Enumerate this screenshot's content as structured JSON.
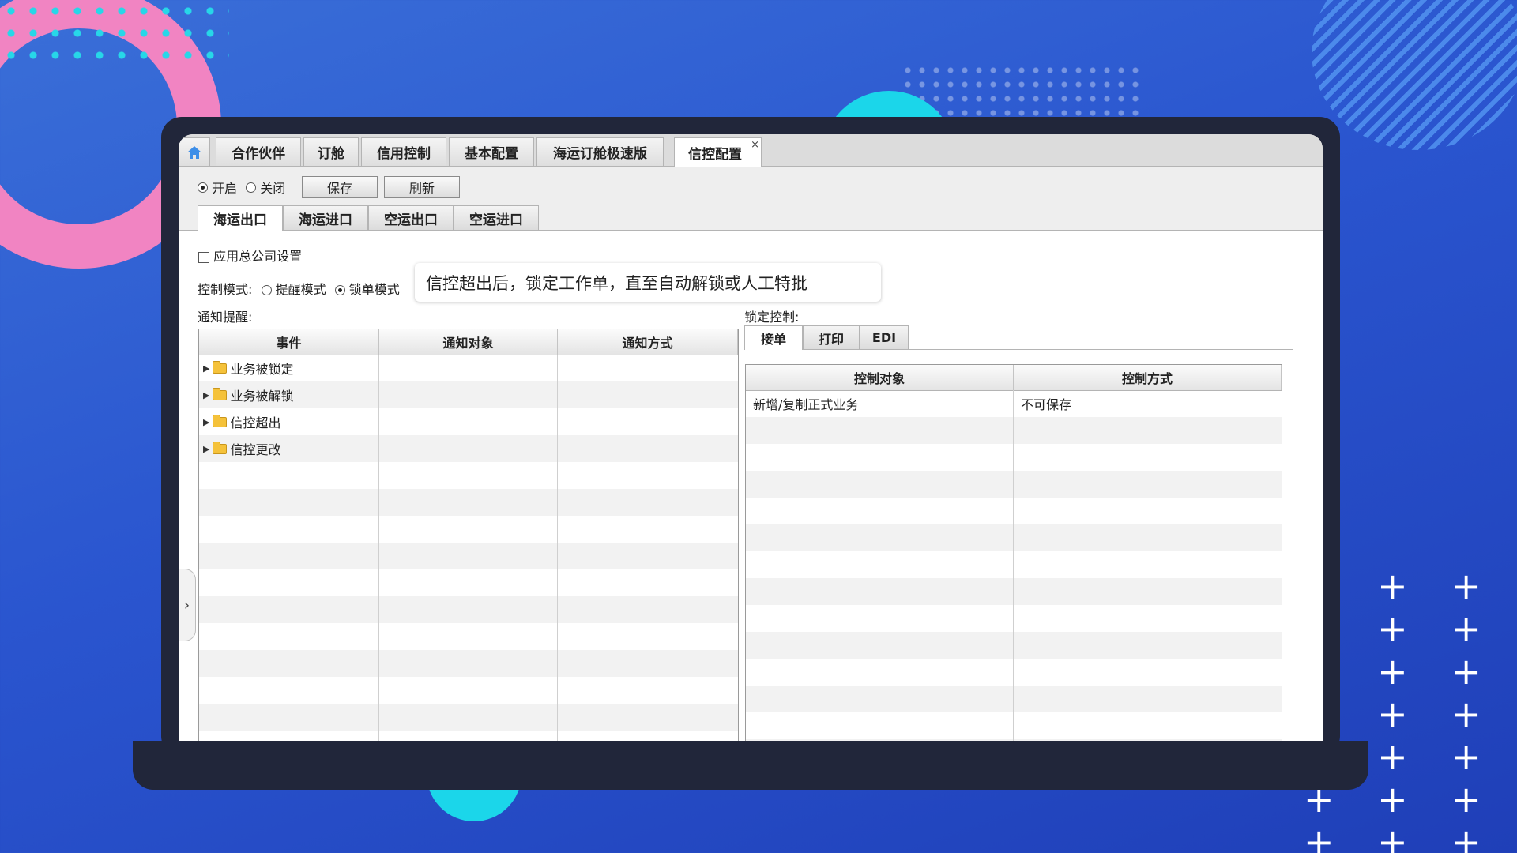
{
  "top_tabs": [
    {
      "label": "合作伙伴"
    },
    {
      "label": "订舱"
    },
    {
      "label": "信用控制"
    },
    {
      "label": "基本配置"
    },
    {
      "label": "海运订舱极速版"
    },
    {
      "label": "信控配置",
      "active": true,
      "close": "×"
    }
  ],
  "toolbar": {
    "on_label": "开启",
    "off_label": "关闭",
    "save_label": "保存",
    "refresh_label": "刷新"
  },
  "sub_tabs": [
    {
      "label": "海运出口",
      "active": true
    },
    {
      "label": "海运进口"
    },
    {
      "label": "空运出口"
    },
    {
      "label": "空运进口"
    }
  ],
  "apply_company_label": "应用总公司设置",
  "control_mode": {
    "label": "控制模式:",
    "remind": "提醒模式",
    "lock": "锁单模式",
    "selected": "锁单模式"
  },
  "tooltip": "信控超出后，锁定工作单，直至自动解锁或人工特批",
  "notify": {
    "section_label": "通知提醒:",
    "headers": [
      "事件",
      "通知对象",
      "通知方式"
    ],
    "rows": [
      "业务被锁定",
      "业务被解锁",
      "信控超出",
      "信控更改"
    ]
  },
  "lock_control": {
    "section_label": "锁定控制:",
    "tabs": [
      "接单",
      "打印",
      "EDI"
    ],
    "headers": [
      "控制对象",
      "控制方式"
    ],
    "rows": [
      {
        "object": "新增/复制正式业务",
        "method": "不可保存"
      }
    ]
  },
  "colors": {
    "background": "#2a55cf",
    "laptop": "#21263a",
    "accent_pink": "#f184c2",
    "accent_cyan": "#1bd6ea"
  }
}
